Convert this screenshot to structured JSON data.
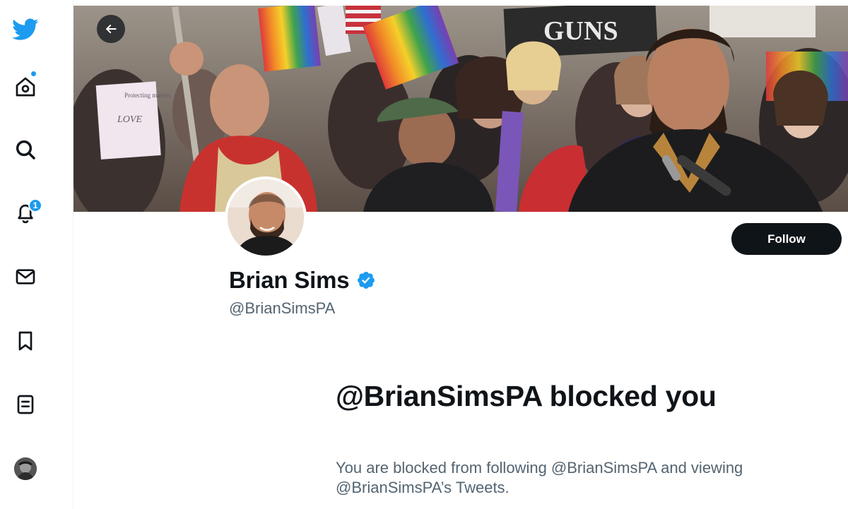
{
  "profile": {
    "display_name": "Brian Sims",
    "handle": "@BrianSimsPA",
    "follow_label": "Follow"
  },
  "blocked": {
    "title": "@BrianSimsPA blocked you",
    "description": "You are blocked from following @BrianSimsPA and viewing @BrianSimsPA’s Tweets."
  },
  "nav": {
    "items": [
      {
        "name": "twitter-logo",
        "icon": "bird-icon"
      },
      {
        "name": "home",
        "icon": "home-icon",
        "has_dot": true
      },
      {
        "name": "explore",
        "icon": "search-icon"
      },
      {
        "name": "notifications",
        "icon": "bell-icon",
        "badge": "1"
      },
      {
        "name": "messages",
        "icon": "mail-icon"
      },
      {
        "name": "bookmarks",
        "icon": "bookmark-icon"
      },
      {
        "name": "lists",
        "icon": "list-icon"
      },
      {
        "name": "account",
        "icon": "avatar"
      }
    ]
  },
  "banner": {
    "sign_text": "GUNS",
    "sign_text_2": "Protecting matters",
    "sign_text_3": "LOVE"
  },
  "colors": {
    "brand": "#1d9bf0",
    "text_primary": "#0f1419",
    "text_secondary": "#536471",
    "follow_bg": "#0f1419"
  }
}
